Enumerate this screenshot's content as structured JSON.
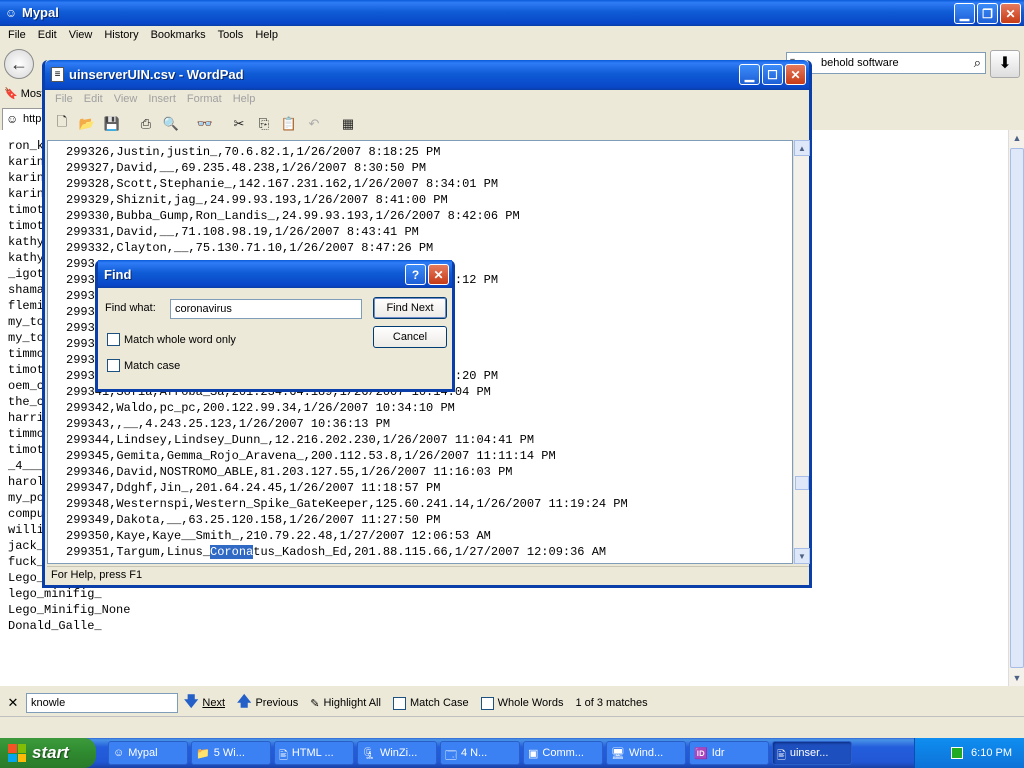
{
  "browser": {
    "title": "Mypal",
    "menu": [
      "File",
      "Edit",
      "View",
      "History",
      "Bookmarks",
      "Tools",
      "Help"
    ],
    "search_value": "behold software",
    "bookmark_label": "Most",
    "tab_label": "http",
    "content_lines": [
      "ron_k",
      "karin",
      "karin",
      "karin",
      "timot",
      "timot",
      "kathy",
      "kathy",
      "_igot",
      "shama",
      "flemi",
      "my_to",
      "my_to",
      "timmo",
      "timot",
      "oem_c",
      "the_c",
      "harri",
      "timmo",
      "timot",
      "_4___",
      "harol",
      "my_po",
      "compu",
      "willi",
      "jack_",
      "fuck_",
      "Lego_",
      "lego_minifig_",
      "Lego_Minifig_None",
      "Donald_Galle_"
    ],
    "findbar": {
      "close": "✕",
      "input": "knowle",
      "next": "Next",
      "previous": "Previous",
      "highlight_all": "Highlight All",
      "match_case": "Match Case",
      "whole_words": "Whole Words",
      "status": "1 of 3 matches"
    }
  },
  "wordpad": {
    "title": "uinserverUIN.csv - WordPad",
    "menu": [
      "File",
      "Edit",
      "View",
      "Insert",
      "Format",
      "Help"
    ],
    "status": "For Help, press F1",
    "lines": [
      {
        "text": "299326,Justin,justin_,70.6.82.1,1/26/2007 8:18:25 PM"
      },
      {
        "text": "299327,David,__,69.235.48.238,1/26/2007 8:30:50 PM"
      },
      {
        "text": "299328,Scott,Stephanie_,142.167.231.162,1/26/2007 8:34:01 PM"
      },
      {
        "text": "299329,Shiznit,jag_,24.99.93.193,1/26/2007 8:41:00 PM"
      },
      {
        "text": "299330,Bubba_Gump,Ron_Landis_,24.99.93.193,1/26/2007 8:42:06 PM"
      },
      {
        "text": "299331,David,__,71.108.98.19,1/26/2007 8:43:41 PM"
      },
      {
        "text": "299332,Clayton,__,75.130.71.10,1/26/2007 8:47:26 PM"
      },
      {
        "text": "2993"
      },
      {
        "text": "2993                                        /2007 9:13:12 PM"
      },
      {
        "text": "2993                                         PM"
      },
      {
        "text": "2993                                        :30:08 PM"
      },
      {
        "text": "2993                                        :12 PM"
      },
      {
        "text": "2993                                        9:54:41 PM"
      },
      {
        "text": "2993                                         PM"
      },
      {
        "text": "2993                                        2007 10:13:20 PM"
      },
      {
        "text": "299341,Sofia,Afroba_Sa,201.234.64.189,1/26/2007 10:14:04 PM"
      },
      {
        "text": "299342,Waldo,pc_pc,200.122.99.34,1/26/2007 10:34:10 PM"
      },
      {
        "text": "299343,,__,4.243.25.123,1/26/2007 10:36:13 PM"
      },
      {
        "text": "299344,Lindsey,Lindsey_Dunn_,12.216.202.230,1/26/2007 11:04:41 PM"
      },
      {
        "text": "299345,Gemita,Gemma_Rojo_Aravena_,200.112.53.8,1/26/2007 11:11:14 PM"
      },
      {
        "text": "299346,David,NOSTROMO_ABLE,81.203.127.55,1/26/2007 11:16:03 PM"
      },
      {
        "text": "299347,Ddghf,Jin_,201.64.24.45,1/26/2007 11:18:57 PM"
      },
      {
        "text": "299348,Westernspi,Western_Spike_GateKeeper,125.60.241.14,1/26/2007 11:19:24 PM"
      },
      {
        "text": "299349,Dakota,__,63.25.120.158,1/26/2007 11:27:50 PM"
      },
      {
        "text": "299350,Kaye,Kaye__Smith_,210.79.22.48,1/27/2007 12:06:53 AM"
      }
    ],
    "last_line": {
      "before": "299351,Targum,Linus_",
      "highlight": "Corona",
      "after": "tus_Kadosh_Ed,201.88.115.66,1/27/2007 12:09:36 AM"
    }
  },
  "find_dialog": {
    "title": "Find",
    "find_what_label": "Find what:",
    "find_what_value": "coronavirus",
    "match_whole_word": "Match whole word only",
    "match_case": "Match case",
    "find_next": "Find Next",
    "cancel": "Cancel",
    "help_button": "?",
    "close_button": "✕"
  },
  "taskbar": {
    "start": "start",
    "tasks": [
      "Mypal",
      "5 Wi...",
      "HTML ...",
      "WinZi...",
      "4 N...",
      "Comm...",
      "Wind...",
      "Idr",
      "uinser..."
    ],
    "clock": "6:10 PM"
  }
}
